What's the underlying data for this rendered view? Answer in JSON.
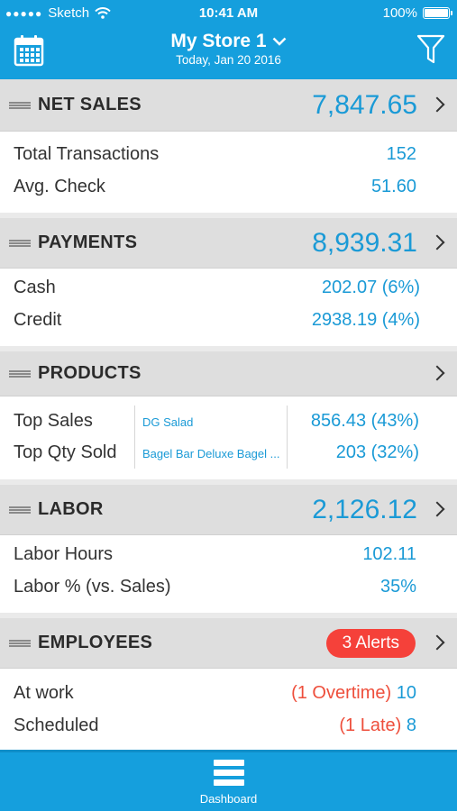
{
  "status_bar": {
    "carrier": "Sketch",
    "time": "10:41 AM",
    "battery": "100%",
    "battery_level": 1.0
  },
  "header": {
    "title": "My Store 1",
    "subtitle": "Today, Jan 20 2016",
    "calendar_icon": "calendar-icon",
    "filter_icon": "filter-icon"
  },
  "net_sales": {
    "title": "NET SALES",
    "value": "7,847.65",
    "rows": [
      {
        "label": "Total Transactions",
        "value": "152"
      },
      {
        "label": "Avg. Check",
        "value": "51.60"
      }
    ]
  },
  "payments": {
    "title": "PAYMENTS",
    "value": "8,939.31",
    "rows": [
      {
        "label": "Cash",
        "value": "202.07 (6%)"
      },
      {
        "label": "Credit",
        "value": "2938.19 (4%)"
      }
    ]
  },
  "products": {
    "title": "PRODUCTS",
    "rows": [
      {
        "label": "Top Sales",
        "item": "DG Salad",
        "value": "856.43 (43%)"
      },
      {
        "label": "Top Qty Sold",
        "item": "Bagel Bar Deluxe Bagel ...",
        "value": "203 (32%)"
      }
    ]
  },
  "labor": {
    "title": "LABOR",
    "value": "2,126.12",
    "rows": [
      {
        "label": "Labor Hours",
        "value": "102.11"
      },
      {
        "label": "Labor % (vs. Sales)",
        "value": "35%"
      }
    ]
  },
  "employees": {
    "title": "EMPLOYEES",
    "alerts": "3 Alerts",
    "rows": [
      {
        "label": "At work",
        "note": "(1 Overtime)",
        "value": "10"
      },
      {
        "label": "Scheduled",
        "note": "(1 Late)",
        "value": "8"
      }
    ]
  },
  "tabbar": {
    "dashboard_label": "Dashboard",
    "dashboard_icon": "dashboard-icon"
  },
  "colors": {
    "brand": "#159fdd",
    "value_blue": "#1a9ad6",
    "alert_red": "#f5413a",
    "section_gray": "#dedede"
  }
}
